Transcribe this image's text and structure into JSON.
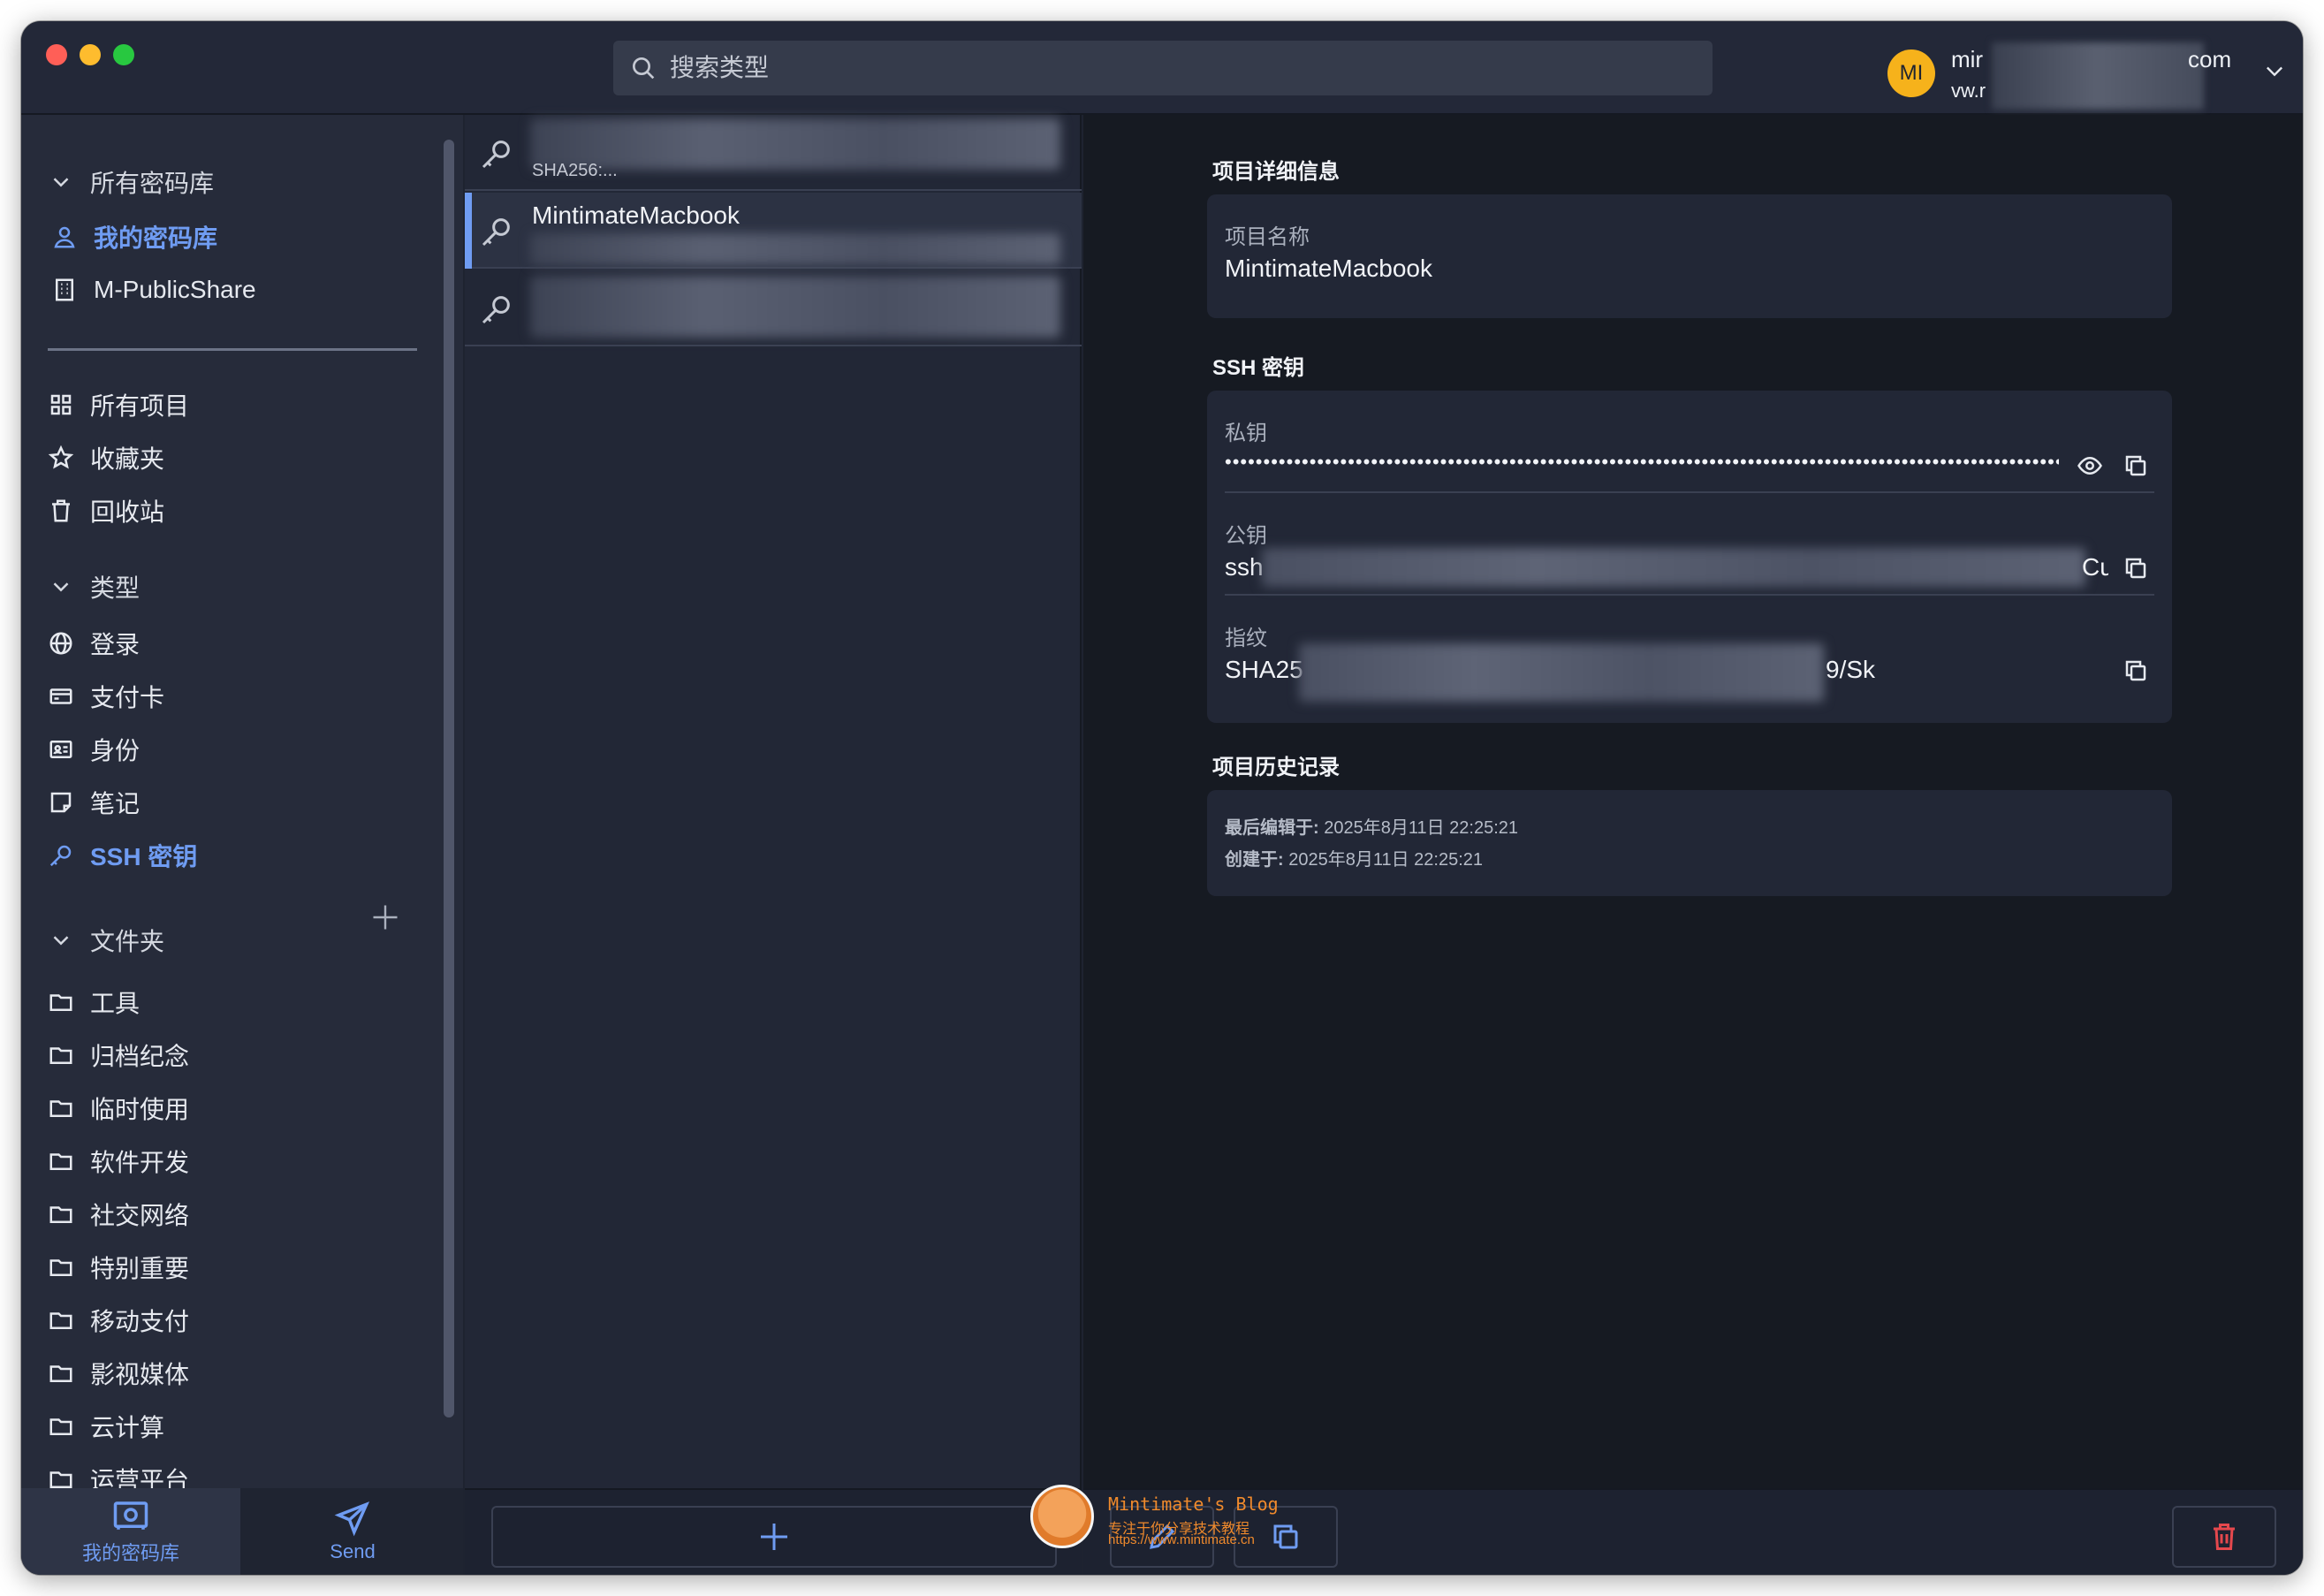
{
  "header": {
    "search_placeholder": "搜索类型",
    "account_initials": "MI",
    "account_line1": "mir",
    "account_suffix": "com",
    "account_line2": "vw.r"
  },
  "sidebar": {
    "vaults_heading": "所有密码库",
    "vaults": [
      {
        "label": "我的密码库",
        "icon": "user-icon",
        "active": true
      },
      {
        "label": "M-PublicShare",
        "icon": "building-icon",
        "active": false
      }
    ],
    "filters": [
      {
        "label": "所有项目",
        "icon": "grid-icon"
      },
      {
        "label": "收藏夹",
        "icon": "star-icon"
      },
      {
        "label": "回收站",
        "icon": "trash-icon"
      }
    ],
    "types_heading": "类型",
    "types": [
      {
        "label": "登录",
        "icon": "globe-icon"
      },
      {
        "label": "支付卡",
        "icon": "credit-card-icon"
      },
      {
        "label": "身份",
        "icon": "id-card-icon"
      },
      {
        "label": "笔记",
        "icon": "note-icon"
      },
      {
        "label": "SSH 密钥",
        "icon": "key-icon",
        "active": true
      }
    ],
    "folders_heading": "文件夹",
    "folders": [
      "工具",
      "归档纪念",
      "临时使用",
      "软件开发",
      "社交网络",
      "特别重要",
      "移动支付",
      "影视媒体",
      "云计算",
      "运营平台"
    ],
    "bottom_tabs": [
      {
        "label": "我的密码库",
        "icon": "vault-icon"
      },
      {
        "label": "Send",
        "icon": "send-icon"
      }
    ]
  },
  "list": {
    "items": [
      {
        "title": "",
        "subtitle": "SHA256:...",
        "selected": false
      },
      {
        "title": "MintimateMacbook",
        "subtitle": "",
        "selected": true
      },
      {
        "title": "",
        "subtitle": "",
        "selected": false
      }
    ]
  },
  "detail": {
    "item_section_title": "项目详细信息",
    "name_label": "项目名称",
    "name_value": "MintimateMacbook",
    "ssh_section_title": "SSH 密钥",
    "private_key_label": "私钥",
    "private_key_mask": "••••••••••••••••••••••••••••••••••••••••••••••••••••••••••••••••••••••••••••••••••••••••••••••••••••••••••••••••••",
    "public_key_label": "公钥",
    "public_key_prefix": "ssh",
    "public_key_suffix": "Cu",
    "fingerprint_label": "指纹",
    "fingerprint_prefix": "SHA25",
    "fingerprint_suffix": "9/Sk",
    "history_section_title": "项目历史记录",
    "last_edited_label": "最后编辑于:",
    "last_edited_value": "2025年8月11日 22:25:21",
    "created_label": "创建于:",
    "created_value": "2025年8月11日 22:25:21"
  },
  "watermark": {
    "line1": "Mintimate's Blog",
    "line2": "专注于你分享技术教程",
    "line3": "https://www.mintimate.cn"
  },
  "colors": {
    "accent": "#6f9cf2",
    "danger": "#e5484d",
    "avatar": "#f6b21b"
  }
}
